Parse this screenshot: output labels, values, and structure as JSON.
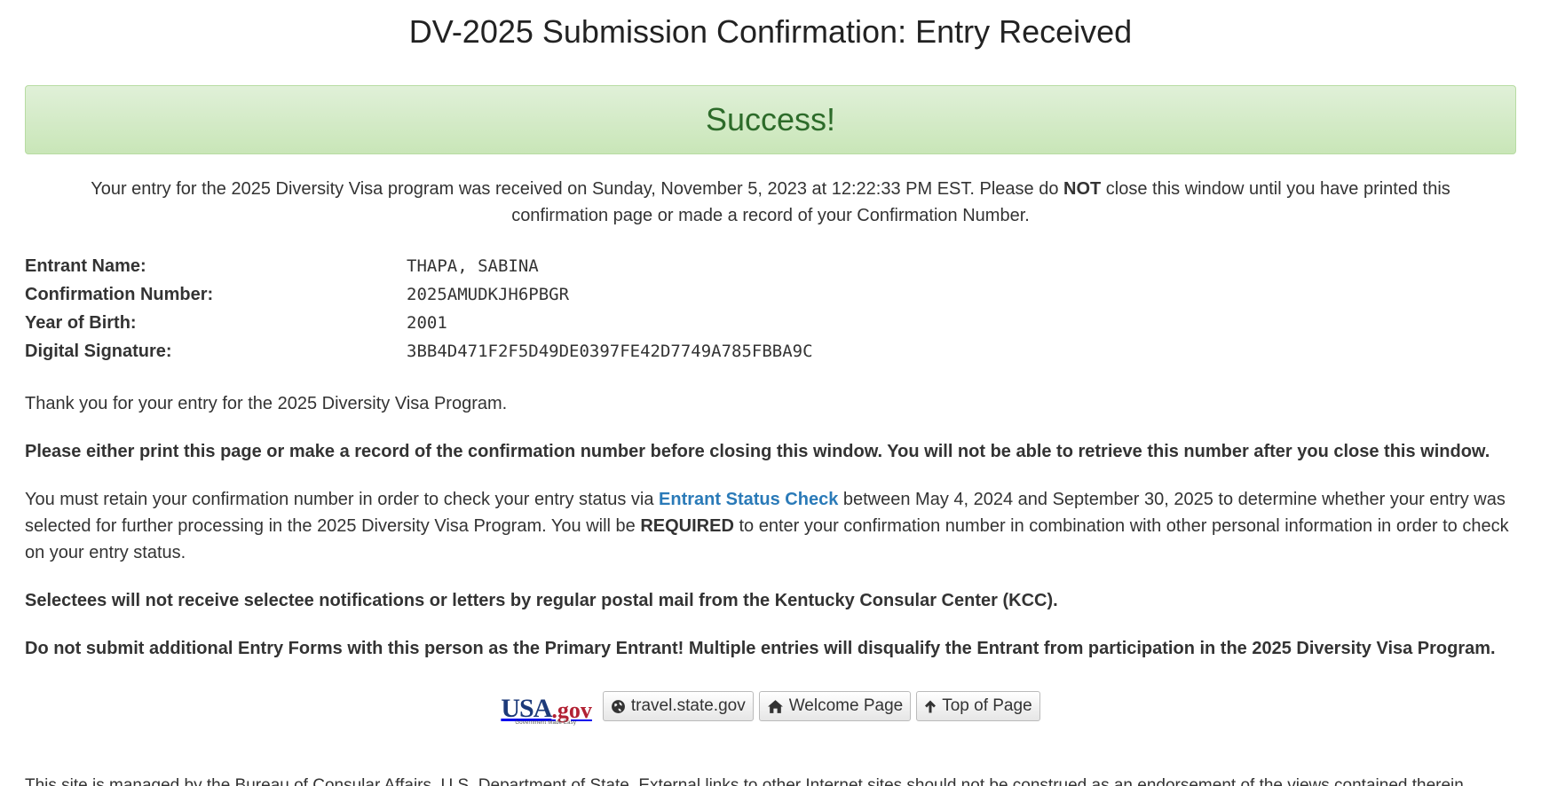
{
  "page": {
    "title": "DV-2025 Submission Confirmation: Entry Received"
  },
  "alert": {
    "text": "Success!"
  },
  "intro": {
    "before": "Your entry for the 2025 Diversity Visa program was received on Sunday, November 5, 2023 at 12:22:33 PM EST. Please do ",
    "emphasis": "NOT",
    "after": " close this window until you have printed this confirmation page or made a record of your Confirmation Number."
  },
  "details": [
    {
      "label": "Entrant Name:",
      "value": "THAPA, SABINA"
    },
    {
      "label": "Confirmation Number:",
      "value": "2025AMUDKJH6PBGR"
    },
    {
      "label": "Year of Birth:",
      "value": "2001"
    },
    {
      "label": "Digital Signature:",
      "value": "3BB4D471F2F5D49DE0397FE42D7749A785FBBA9C"
    }
  ],
  "body": {
    "thanks": "Thank you for your entry for the 2025 Diversity Visa Program.",
    "print_warning": "Please either print this page or make a record of the confirmation number before closing this window. You will not be able to retrieve this number after you close this window.",
    "retain_before": "You must retain your confirmation number in order to check your entry status via ",
    "retain_link": "Entrant Status Check",
    "retain_middle": " between May 4, 2024 and September 30, 2025 to determine whether your entry was selected for further processing in the 2025 Diversity Visa Program. You will be ",
    "retain_emphasis": "REQUIRED",
    "retain_after": " to enter your confirmation number in combination with other personal information in order to check on your entry status.",
    "selectees": "Selectees will not receive selectee notifications or letters by regular postal mail from the Kentucky Consular Center (KCC).",
    "do_not_submit": "Do not submit additional Entry Forms with this person as the Primary Entrant! Multiple entries will disqualify the Entrant from participation in the 2025 Diversity Visa Program."
  },
  "footer": {
    "logo_usa": "USA",
    "logo_gov": ".gov",
    "logo_sub": "Government Made Easy",
    "buttons": [
      {
        "label": "travel.state.gov",
        "icon": "globe-icon"
      },
      {
        "label": "Welcome Page",
        "icon": "home-icon"
      },
      {
        "label": "Top of Page",
        "icon": "arrow-up-icon"
      }
    ],
    "fine_print": "This site is managed by the Bureau of Consular Affairs, U.S. Department of State. External links to other Internet sites should not be construed as an endorsement of the views contained therein."
  },
  "colors": {
    "link": "#2a7ab8",
    "success_text": "#2d6b2a",
    "success_bg": "#d6ecc9"
  }
}
